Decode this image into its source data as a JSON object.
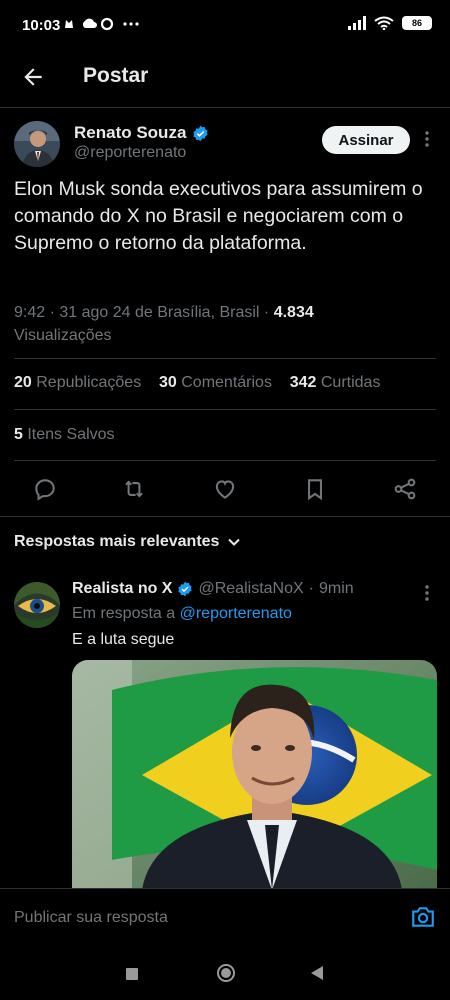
{
  "status_bar": {
    "time": "10:03",
    "battery": "86",
    "left_icons": [
      "cat-icon",
      "cloud-icon",
      "circle-icon",
      "more-icon"
    ],
    "right_icons": [
      "signal-icon",
      "wifi-icon",
      "battery-icon"
    ]
  },
  "header": {
    "title": "Postar"
  },
  "post": {
    "author": {
      "name": "Renato Souza",
      "handle": "@reporterenato",
      "verified": true
    },
    "follow_label": "Assinar",
    "text": "Elon Musk sonda executivos para assumirem o comando do X no Brasil e negociarem com o Supremo o retorno da plataforma.",
    "meta": {
      "time": "9:42",
      "date": "31 ago 24 de Brasília, Brasil",
      "views_count": "4.834",
      "views_label": "Visualizações"
    },
    "stats": {
      "reposts_count": "20",
      "reposts_label": "Republicações",
      "comments_count": "30",
      "comments_label": "Comentários",
      "likes_count": "342",
      "likes_label": "Curtidas",
      "saved_count": "5",
      "saved_label": "Itens Salvos"
    }
  },
  "replies_header": "Respostas mais relevantes",
  "reply": {
    "name": "Realista no X",
    "handle": "@RealistaNoX",
    "time": "9min",
    "in_reply_prefix": "Em resposta a",
    "in_reply_handle": "@reporterenato",
    "text": "E a luta segue"
  },
  "composer": {
    "placeholder": "Publicar sua resposta"
  },
  "colors": {
    "accent": "#1d9bf0",
    "background": "#000000",
    "muted": "#71767b"
  }
}
